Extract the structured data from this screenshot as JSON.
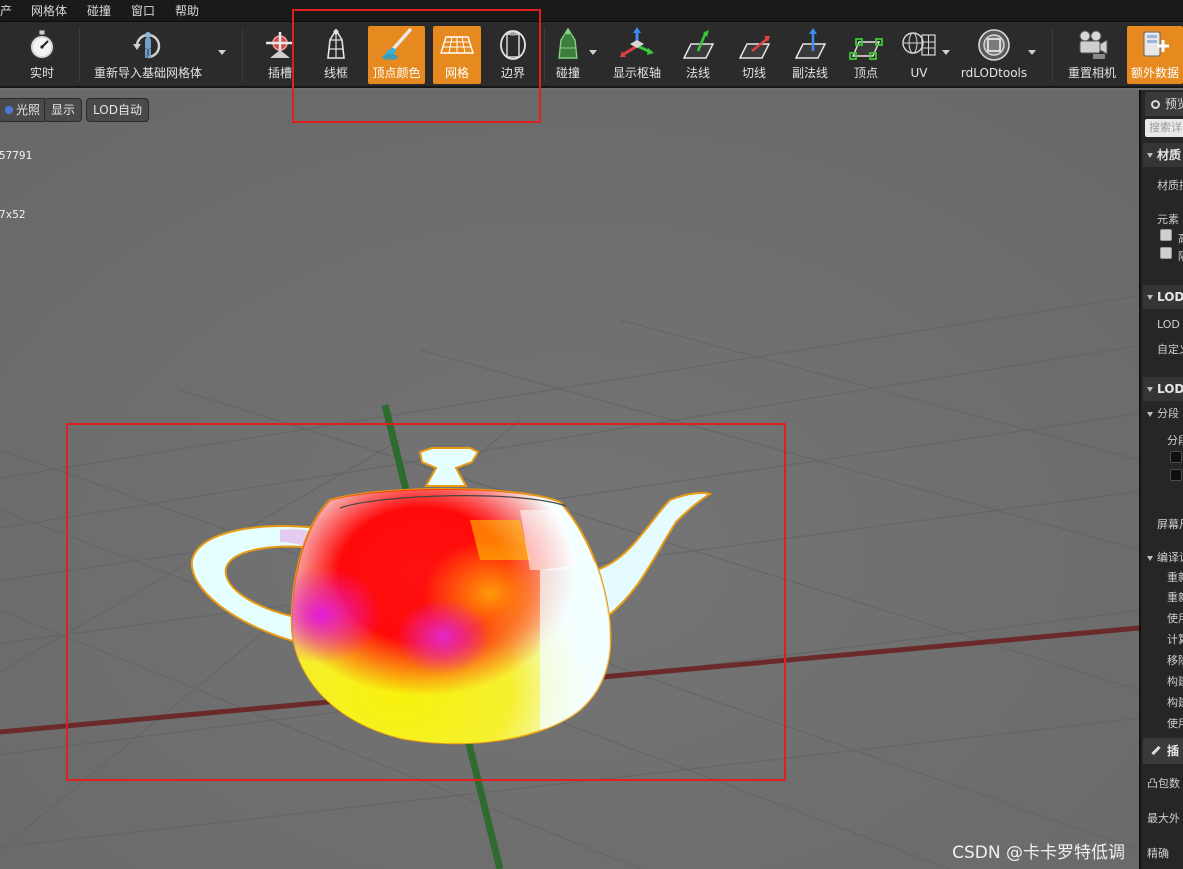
{
  "menubar": {
    "items": [
      "产",
      "网格体",
      "碰撞",
      "窗口",
      "帮助"
    ]
  },
  "toolbar": {
    "buttons": [
      {
        "id": "realtime",
        "label": "实时",
        "icon": "stopwatch-icon",
        "active": false
      },
      {
        "id": "reimport",
        "label": "重新导入基础网格体",
        "icon": "reimport-mannequin-icon",
        "active": false
      },
      {
        "id": "socket",
        "label": "插槽",
        "icon": "socket-icon",
        "active": false
      },
      {
        "id": "wireframe",
        "label": "线框",
        "icon": "wireframe-icon",
        "active": false
      },
      {
        "id": "vertex-color",
        "label": "顶点颜色",
        "icon": "paintbrush-icon",
        "active": true
      },
      {
        "id": "grid",
        "label": "网格",
        "icon": "grid-icon",
        "active": true
      },
      {
        "id": "bounds",
        "label": "边界",
        "icon": "bounds-icon",
        "active": false
      },
      {
        "id": "collision",
        "label": "碰撞",
        "icon": "collision-icon",
        "active": false
      },
      {
        "id": "pivot",
        "label": "显示枢轴",
        "icon": "pivot-axis-icon",
        "active": false
      },
      {
        "id": "normals",
        "label": "法线",
        "icon": "normals-icon",
        "active": false
      },
      {
        "id": "tangents",
        "label": "切线",
        "icon": "tangents-icon",
        "active": false
      },
      {
        "id": "binormals",
        "label": "副法线",
        "icon": "binormals-icon",
        "active": false
      },
      {
        "id": "vertices",
        "label": "顶点",
        "icon": "vertices-icon",
        "active": false
      },
      {
        "id": "uv",
        "label": "UV",
        "icon": "uv-icon",
        "active": false
      },
      {
        "id": "rdlod",
        "label": "rdLODtools",
        "icon": "rdlod-icon",
        "active": false
      },
      {
        "id": "reset-camera",
        "label": "重置相机",
        "icon": "camera-icon",
        "active": false
      },
      {
        "id": "extra-data",
        "label": "额外数据",
        "icon": "extra-data-icon",
        "active": true
      }
    ]
  },
  "viewport": {
    "buttons": {
      "lit": "光照",
      "show": "显示",
      "lod": "LOD自动"
    },
    "stats": {
      "line1": "57791",
      "line2": "7x52"
    },
    "watermark": "CSDN @卡卡罗特低调"
  },
  "panel": {
    "tab": "预览",
    "search_placeholder": "搜索详",
    "sections": {
      "materials": "材质",
      "lod_settings": "LOD设",
      "lod": "LOD",
      "sections_sub": "分段",
      "build": "编译设",
      "collision": "插"
    },
    "rows": {
      "material_slots": "材质插",
      "elements": "元素",
      "highlight": "高",
      "isolate": "隔",
      "lod": "LOD",
      "custom": "自定义",
      "section_sub": "分段",
      "screen_size": "屏幕尺",
      "recompute_normals": "重新",
      "recompute_tangents": "重新",
      "use_mikk": "使用",
      "compute": "计算",
      "remove": "移除",
      "build_a": "构建",
      "build_b": "构建",
      "use_full": "使用",
      "convex_count": "凸包数",
      "max_hull": "最大外",
      "precision": "精确"
    }
  },
  "colors": {
    "accent": "#e6891e",
    "toolbar_bg": "#2b2b2b",
    "viewport_bg": "#6e6e6e",
    "annotation": "#e02020"
  }
}
